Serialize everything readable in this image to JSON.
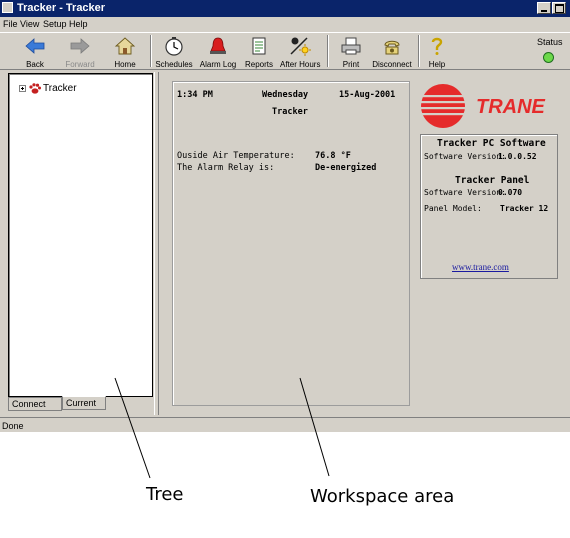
{
  "window": {
    "title": "Tracker - Tracker"
  },
  "menu": [
    "File",
    "View",
    "Setup",
    "Help"
  ],
  "toolbar": {
    "buttons": [
      {
        "label": "Back",
        "icon": "back-arrow-icon",
        "enabled": true
      },
      {
        "label": "Forward",
        "icon": "forward-arrow-icon",
        "enabled": false
      },
      {
        "label": "Home",
        "icon": "home-icon",
        "enabled": true
      },
      {
        "label": "Schedules",
        "icon": "clock-icon",
        "enabled": true
      },
      {
        "label": "Alarm Log",
        "icon": "alarm-bell-icon",
        "enabled": true
      },
      {
        "label": "Reports",
        "icon": "report-icon",
        "enabled": true
      },
      {
        "label": "After Hours",
        "icon": "after-hours-icon",
        "enabled": true
      },
      {
        "label": "Print",
        "icon": "printer-icon",
        "enabled": true
      },
      {
        "label": "Disconnect",
        "icon": "phone-icon",
        "enabled": true
      },
      {
        "label": "Help",
        "icon": "help-question-icon",
        "enabled": true
      }
    ],
    "status_label": "Status",
    "status_color": "#6cd84a"
  },
  "tree": {
    "root_label": "Tracker"
  },
  "tabs": [
    "Connect",
    "Current"
  ],
  "workspace": {
    "time": "1:34 PM",
    "day": "Wednesday",
    "date": "15-Aug-2001",
    "site": "Tracker",
    "rows": [
      {
        "label": "Ouside Air Temperature:",
        "value": "76.8 °F"
      },
      {
        "label": "The Alarm Relay is:",
        "value": "De-energized"
      }
    ]
  },
  "info": {
    "logo_text": "TRANE",
    "logo_color": "#e52b2b",
    "software_title": "Tracker PC Software",
    "software_version_label": "Software Version:",
    "software_version": "1.0.0.52",
    "panel_title": "Tracker Panel",
    "panel_version_label": "Software Version:",
    "panel_version": "0.070",
    "panel_model_label": "Panel Model:",
    "panel_model": "Tracker 12",
    "link": "www.trane.com"
  },
  "statusbar": {
    "text": "Done"
  },
  "callouts": {
    "tree": "Tree",
    "workspace": "Workspace area"
  }
}
